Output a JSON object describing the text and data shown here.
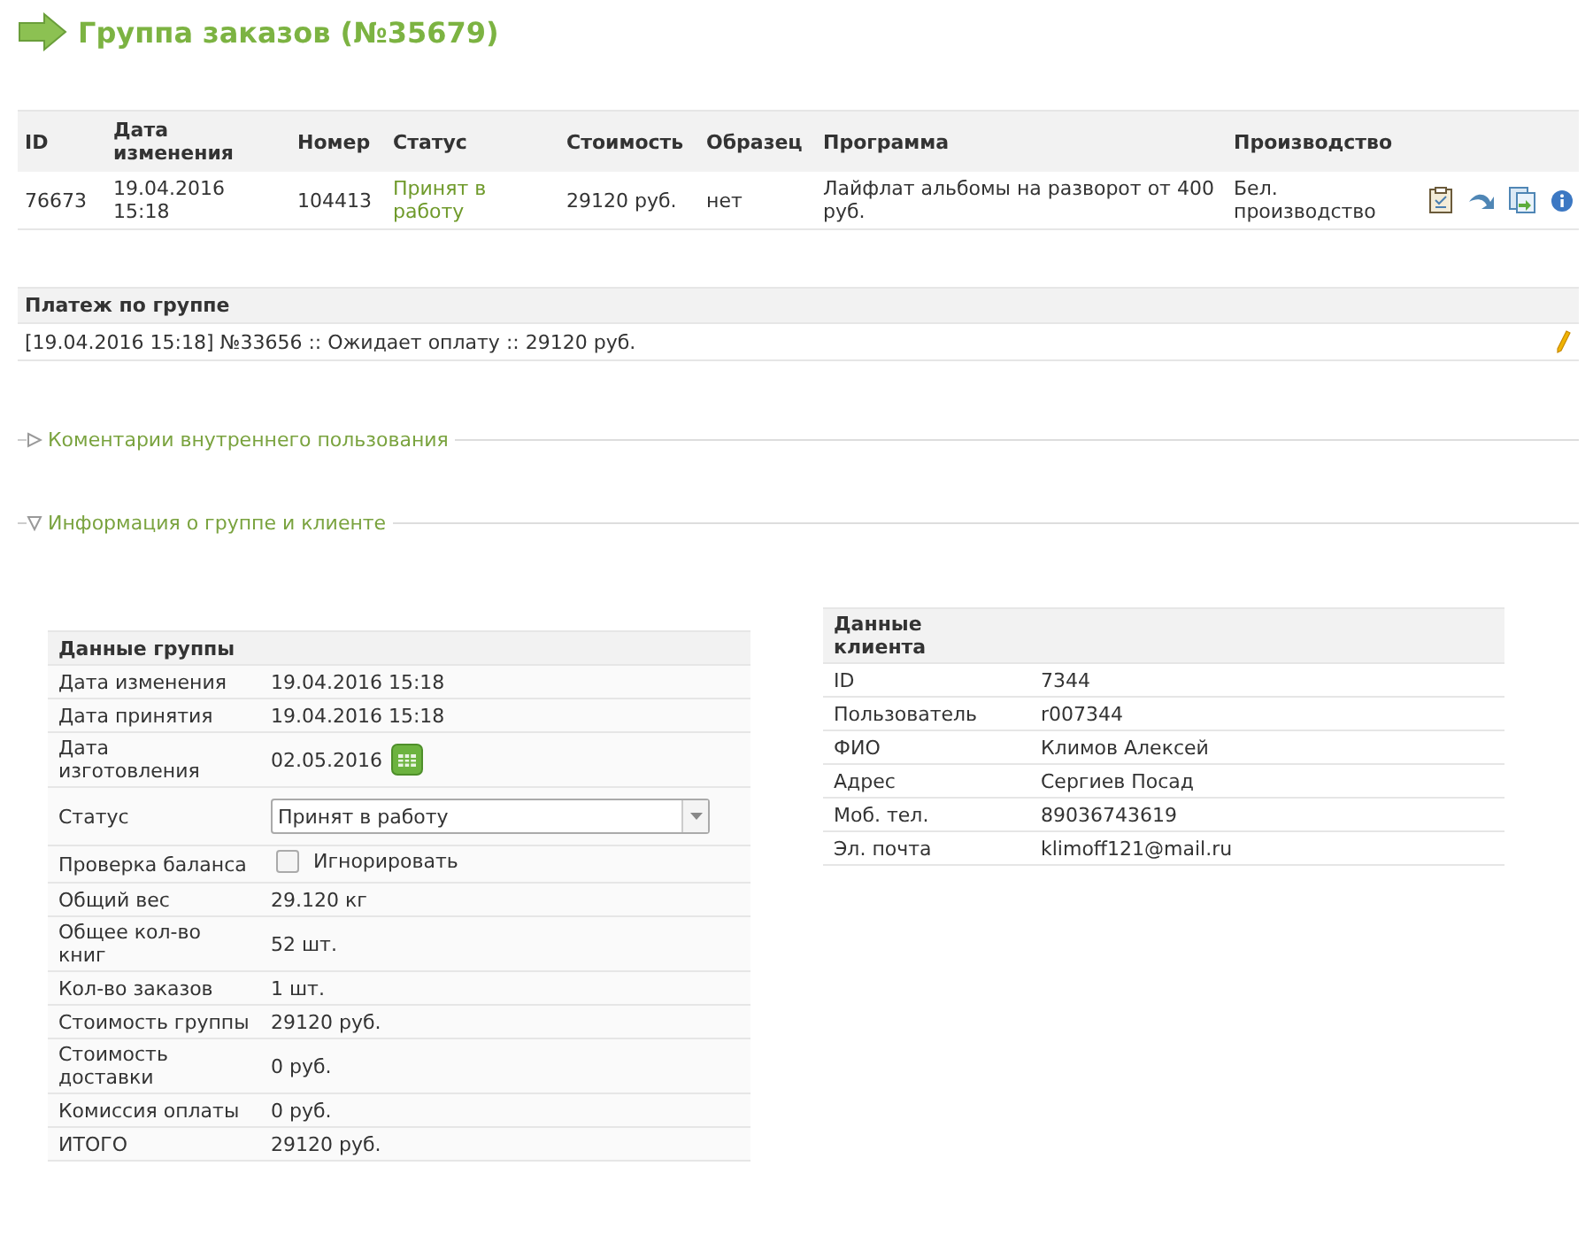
{
  "page_title": "Группа заказов (№35679)",
  "orders": {
    "columns": [
      "ID",
      "Дата изменения",
      "Номер",
      "Статус",
      "Стоимость",
      "Образец",
      "Программа",
      "Производство"
    ],
    "rows": [
      {
        "id": "76673",
        "date": "19.04.2016 15:18",
        "number": "104413",
        "status": "Принят в работу",
        "cost": "29120 руб.",
        "sample": "нет",
        "program": "Лайфлат альбомы на разворот от 400 руб.",
        "production": "Бел. производство"
      }
    ]
  },
  "payment": {
    "title": "Платеж по группе",
    "entries": [
      "[19.04.2016 15:18] №33656 :: Ожидает оплату :: 29120 руб."
    ]
  },
  "sections": [
    {
      "title": "Коментарии внутреннего пользования",
      "expanded": false
    },
    {
      "title": "Информация о группе и клиенте",
      "expanded": true
    }
  ],
  "group_data": {
    "title": "Данные группы",
    "rows": [
      {
        "kind": "text",
        "label": "Дата изменения",
        "value": "19.04.2016 15:18"
      },
      {
        "kind": "text",
        "label": "Дата принятия",
        "value": "19.04.2016 15:18"
      },
      {
        "kind": "date",
        "label": "Дата изготовления",
        "value": "02.05.2016"
      },
      {
        "kind": "select",
        "label": "Статус",
        "value": "Принят в работу"
      },
      {
        "kind": "checkbox",
        "label": "Проверка баланса",
        "value": "Игнорировать",
        "checked": false
      },
      {
        "kind": "text",
        "label": "Общий вес",
        "value": "29.120 кг"
      },
      {
        "kind": "text",
        "label": "Общее кол-во книг",
        "value": "52 шт."
      },
      {
        "kind": "text",
        "label": "Кол-во заказов",
        "value": "1 шт."
      },
      {
        "kind": "text",
        "label": "Стоимость группы",
        "value": "29120 руб."
      },
      {
        "kind": "text",
        "label": "Стоимость доставки",
        "value": "0 руб."
      },
      {
        "kind": "text",
        "label": "Комиссия оплаты",
        "value": "0 руб."
      },
      {
        "kind": "text",
        "label": "ИТОГО",
        "value": "29120 руб."
      }
    ]
  },
  "client_data": {
    "title": "Данные клиента",
    "rows": [
      {
        "label": "ID",
        "value": "7344"
      },
      {
        "label": "Пользователь",
        "value": "r007344"
      },
      {
        "label": "ФИО",
        "value": "Климов Алексей"
      },
      {
        "label": "Адрес",
        "value": "Сергиев Посад"
      },
      {
        "label": "Моб. тел.",
        "value": "89036743619"
      },
      {
        "label": "Эл. почта",
        "value": "klimoff121@mail.ru"
      }
    ]
  }
}
